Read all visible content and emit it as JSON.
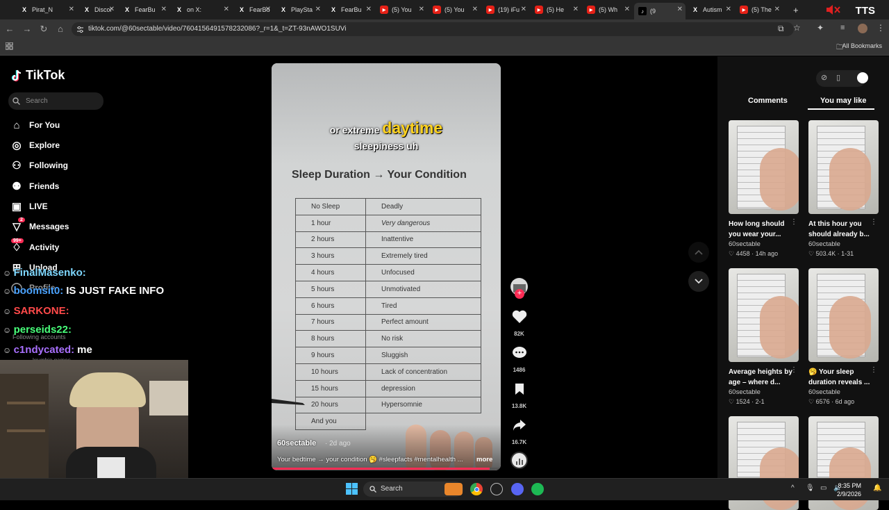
{
  "browser": {
    "tabs": [
      {
        "label": "Pirat_N",
        "icon": "x-icon"
      },
      {
        "label": "Discor",
        "icon": "x-icon"
      },
      {
        "label": "FearBu",
        "icon": "x-icon"
      },
      {
        "label": "on X:",
        "icon": "x-icon"
      },
      {
        "label": "FearBu",
        "icon": "x-icon"
      },
      {
        "label": "PlaySta",
        "icon": "x-icon"
      },
      {
        "label": "FearBu",
        "icon": "x-icon"
      },
      {
        "label": "(5) You",
        "icon": "youtube-icon"
      },
      {
        "label": "(5) You",
        "icon": "youtube-icon"
      },
      {
        "label": "(19) iFu",
        "icon": "youtube-icon"
      },
      {
        "label": "(5) He",
        "icon": "youtube-icon"
      },
      {
        "label": "(5) Wh",
        "icon": "youtube-icon"
      },
      {
        "label": "(9",
        "icon": "tiktok-icon"
      },
      {
        "label": "Autism",
        "icon": "x-icon"
      },
      {
        "label": "(5) The",
        "icon": "youtube-icon"
      }
    ],
    "new_tab": "+",
    "overlay_tts": "TTS",
    "url": "tiktok.com/@60sectable/video/7604156491578232086?_r=1&_t=ZT-93nAWO1SUVi",
    "all_bookmarks": "All Bookmarks"
  },
  "tiktok": {
    "logo": "TikTok",
    "search_placeholder": "Search",
    "nav": [
      {
        "label": "For You",
        "icon": "home-icon"
      },
      {
        "label": "Explore",
        "icon": "compass-icon"
      },
      {
        "label": "Following",
        "icon": "following-icon"
      },
      {
        "label": "Friends",
        "icon": "friends-icon"
      },
      {
        "label": "LIVE",
        "icon": "live-icon"
      },
      {
        "label": "Messages",
        "icon": "messages-icon",
        "badge": "2"
      },
      {
        "label": "Activity",
        "icon": "activity-icon",
        "badge": "99+"
      },
      {
        "label": "Upload",
        "icon": "upload-icon"
      },
      {
        "label": "Profile",
        "icon": "profile-icon"
      }
    ],
    "following_accounts": "Following accounts",
    "account_hint": "krumbie games"
  },
  "stream_chat": [
    {
      "user": "FinalMasenko:",
      "message": "",
      "color": "#7fd8ff"
    },
    {
      "user": "boomsit0:",
      "message": "IS JUST FAKE INFO",
      "color": "#4ba3ff"
    },
    {
      "user": "SARKONE:",
      "message": "",
      "color": "#ff4a4a"
    },
    {
      "user": "perseids22:",
      "message": "",
      "color": "#48ff7a"
    },
    {
      "user": "c1ndycated:",
      "message": "me",
      "color": "#a970ff"
    }
  ],
  "video": {
    "caption_line1_pre": "or extreme",
    "caption_line1_highlight": "daytime",
    "caption_line2": "sleepiness uh",
    "sheet_title": "Sleep Duration → Your Condition",
    "table": [
      [
        "No Sleep",
        "Deadly"
      ],
      [
        "1 hour",
        "Very dangerous"
      ],
      [
        "2 hours",
        "Inattentive"
      ],
      [
        "3 hours",
        "Extremely tired"
      ],
      [
        "4 hours",
        "Unfocused"
      ],
      [
        "5 hours",
        "Unmotivated"
      ],
      [
        "6 hours",
        "Tired"
      ],
      [
        "7 hours",
        "Perfect amount"
      ],
      [
        "8 hours",
        "No risk"
      ],
      [
        "9 hours",
        "Sluggish"
      ],
      [
        "10 hours",
        "Lack of concentration"
      ],
      [
        "15 hours",
        "depression"
      ],
      [
        "20 hours",
        "Hypersomnie"
      ],
      [
        "And you",
        ""
      ]
    ],
    "author": "60sectable",
    "date": "· 2d ago",
    "description": "Your bedtime → your condition 🥱 #sleepfacts #mentalhealth ...",
    "more": "more",
    "progress": 0.95
  },
  "actions": {
    "likes": "82K",
    "comments": "1486",
    "saves": "13.8K",
    "shares": "16.7K"
  },
  "right_panel": {
    "tabs": [
      "Comments",
      "You may like"
    ],
    "active_tab": "You may like",
    "recommendations": [
      {
        "title": "How long should you wear your...",
        "author": "60sectable",
        "likes": "4458",
        "age": "14h ago"
      },
      {
        "title": "At this hour you should already b...",
        "author": "60sectable",
        "likes": "503.4K",
        "age": "1-31"
      },
      {
        "title": "Average heights by age – where d...",
        "author": "60sectable",
        "likes": "1524",
        "age": "2-1"
      },
      {
        "title": "🥱 Your sleep duration reveals ...",
        "author": "60sectable",
        "likes": "6576",
        "age": "6d ago"
      },
      {
        "title": "",
        "author": "",
        "likes": "",
        "age": ""
      },
      {
        "title": "",
        "author": "",
        "likes": "",
        "age": ""
      }
    ]
  },
  "taskbar": {
    "search": "Search",
    "time": "8:35 PM",
    "date": "2/9/2026"
  },
  "colors": {
    "accent": "#fe2c55",
    "caption_highlight": "#ffd21f"
  }
}
